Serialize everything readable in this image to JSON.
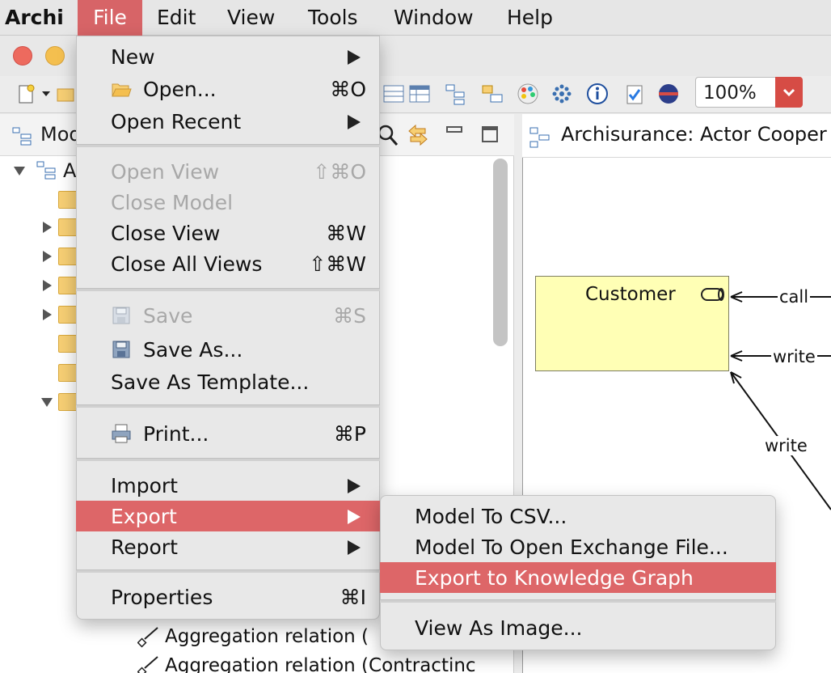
{
  "menubar": {
    "app": "Archi",
    "items": [
      "File",
      "Edit",
      "View",
      "Tools",
      "Window",
      "Help"
    ]
  },
  "toolbar": {
    "zoom": "100%"
  },
  "tree": {
    "header_title": "Mod",
    "root_label": "A",
    "relations": [
      "Aggregation relation (",
      "Aggregation relation (Contractinc"
    ]
  },
  "diagram": {
    "title": "Archisurance: Actor Cooper",
    "element": "Customer",
    "labels": {
      "call": "call",
      "write1": "write",
      "write2": "write"
    }
  },
  "file_menu": {
    "new": "New",
    "open": "Open...",
    "open_sc": "⌘O",
    "open_recent": "Open Recent",
    "open_view": "Open View",
    "open_view_sc": "⇧⌘O",
    "close_model": "Close Model",
    "close_view": "Close View",
    "close_view_sc": "⌘W",
    "close_all_views": "Close All Views",
    "close_all_views_sc": "⇧⌘W",
    "save": "Save",
    "save_sc": "⌘S",
    "save_as": "Save As...",
    "save_as_template": "Save As Template...",
    "print": "Print...",
    "print_sc": "⌘P",
    "import": "Import",
    "export": "Export",
    "report": "Report",
    "properties": "Properties",
    "properties_sc": "⌘I"
  },
  "export_menu": {
    "csv": "Model To CSV...",
    "open_exchange": "Model To Open Exchange File...",
    "knowledge_graph": "Export to Knowledge Graph",
    "view_as_image": "View As Image..."
  },
  "colors": {
    "highlight": "#dd6668",
    "note_fill": "#ffffb5",
    "folder": "#f7cf74"
  }
}
